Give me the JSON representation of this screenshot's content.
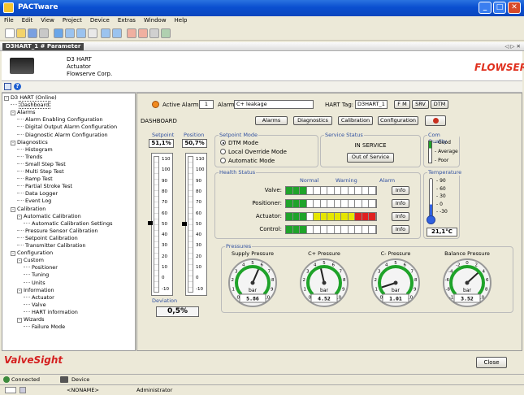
{
  "window": {
    "title": "PACTware"
  },
  "menu": [
    "File",
    "Edit",
    "View",
    "Project",
    "Device",
    "Extras",
    "Window",
    "Help"
  ],
  "doc_tab": "D3HART_1 # Parameter",
  "doc_tab_controls": "◁ ▷ ✕",
  "device": {
    "line1": "D3 HART",
    "line2": "Actuator",
    "line3": "Flowserve Corp.",
    "logo": "FLOWSERVE",
    "logo_color": "#e0301e"
  },
  "tree": [
    {
      "label": "D3 HART (Online)",
      "level": 0,
      "exp": "-"
    },
    {
      "label": "Dashboard",
      "level": 1,
      "exp": "",
      "selected": true
    },
    {
      "label": "Alarms",
      "level": 1,
      "exp": "-"
    },
    {
      "label": "Alarm Enabling Configuration",
      "level": 2,
      "exp": ""
    },
    {
      "label": "Digital Output Alarm Configuration",
      "level": 2,
      "exp": ""
    },
    {
      "label": "Diagnostic Alarm Configuration",
      "level": 2,
      "exp": ""
    },
    {
      "label": "Diagnostics",
      "level": 1,
      "exp": "-"
    },
    {
      "label": "Histogram",
      "level": 2,
      "exp": ""
    },
    {
      "label": "Trends",
      "level": 2,
      "exp": ""
    },
    {
      "label": "Small Step Test",
      "level": 2,
      "exp": ""
    },
    {
      "label": "Multi Step Test",
      "level": 2,
      "exp": ""
    },
    {
      "label": "Ramp Test",
      "level": 2,
      "exp": ""
    },
    {
      "label": "Partial Stroke Test",
      "level": 2,
      "exp": ""
    },
    {
      "label": "Data Logger",
      "level": 2,
      "exp": ""
    },
    {
      "label": "Event Log",
      "level": 2,
      "exp": ""
    },
    {
      "label": "Calibration",
      "level": 1,
      "exp": "-"
    },
    {
      "label": "Automatic Calibration",
      "level": 2,
      "exp": "-"
    },
    {
      "label": "Automatic Calibration Settings",
      "level": 3,
      "exp": ""
    },
    {
      "label": "Pressure Sensor Calibration",
      "level": 2,
      "exp": ""
    },
    {
      "label": "Setpoint Calibration",
      "level": 2,
      "exp": ""
    },
    {
      "label": "Transmitter Calibration",
      "level": 2,
      "exp": ""
    },
    {
      "label": "Configuration",
      "level": 1,
      "exp": "-"
    },
    {
      "label": "Custom",
      "level": 2,
      "exp": "-"
    },
    {
      "label": "Positioner",
      "level": 3,
      "exp": ""
    },
    {
      "label": "Tuning",
      "level": 3,
      "exp": ""
    },
    {
      "label": "Units",
      "level": 3,
      "exp": ""
    },
    {
      "label": "Information",
      "level": 2,
      "exp": "-"
    },
    {
      "label": "Actuator",
      "level": 3,
      "exp": ""
    },
    {
      "label": "Valve",
      "level": 3,
      "exp": ""
    },
    {
      "label": "HART information",
      "level": 3,
      "exp": ""
    },
    {
      "label": "Wizards",
      "level": 2,
      "exp": "-"
    },
    {
      "label": "Failure Mode",
      "level": 3,
      "exp": ""
    }
  ],
  "dashboard": {
    "active_alarms_label": "Active Alarms:",
    "active_alarms_count": "1",
    "alarm_label": "Alarm:",
    "alarm_value": "C+ leakage",
    "hart_tag_label": "HART Tag:",
    "hart_tag_value": "D3HART_1",
    "fm": "F M",
    "srv": "SRV",
    "dtm": "DTM",
    "title": "DASHBOARD",
    "buttons": {
      "alarms": "Alarms",
      "diagnostics": "Diagnostics",
      "calibration": "Calibration",
      "configuration": "Configuration"
    },
    "setpoint_label": "Setpoint",
    "setpoint_value": "51,1%",
    "position_label": "Position",
    "position_value": "50,7%",
    "scale_ticks": [
      "110",
      "100",
      "90",
      "80",
      "70",
      "60",
      "50",
      "40",
      "30",
      "20",
      "10",
      "0",
      "-10"
    ],
    "setpoint_level": 51.1,
    "position_level": 50.7,
    "deviation_label": "Deviation",
    "deviation_value": "0,5%",
    "setpoint_mode": {
      "label": "Setpoint Mode",
      "options": [
        "DTM Mode",
        "Local Override Mode",
        "Automatic Mode"
      ],
      "selected": 0
    },
    "service_status": {
      "label": "Service Status",
      "value": "IN SERVICE",
      "button": "Out of Service"
    },
    "com_quality": {
      "label": "Com Quality",
      "levels": [
        "Good",
        "Average",
        "Poor"
      ]
    },
    "health": {
      "label": "Health Status",
      "headers": [
        "Normal",
        "Warning",
        "Alarm"
      ],
      "rows": [
        {
          "name": "Valve:",
          "green": 3,
          "yellow": 0,
          "red": 0,
          "info": "Info"
        },
        {
          "name": "Positioner:",
          "green": 3,
          "yellow": 0,
          "red": 0,
          "info": "Info"
        },
        {
          "name": "Actuator:",
          "green": 3,
          "yellow": 6,
          "red": 3,
          "info": "Info"
        },
        {
          "name": "Control:",
          "green": 3,
          "yellow": 0,
          "red": 0,
          "info": "Info"
        }
      ]
    },
    "temperature": {
      "label": "Temperature",
      "ticks": [
        "90",
        "60",
        "30",
        "0",
        "-30"
      ],
      "value": "21,1°C"
    },
    "pressures": {
      "label": "Pressures",
      "gauges": [
        {
          "name": "Supply Pressure",
          "value": "5.86",
          "unit": "bar",
          "ticks": [
            "0",
            "1",
            "2",
            "3",
            "4",
            "5",
            "6",
            "7",
            "8",
            "9",
            "10"
          ],
          "frac": 0.586
        },
        {
          "name": "C+ Pressure",
          "value": "4.52",
          "unit": "bar",
          "ticks": [
            "0",
            "1",
            "2",
            "3",
            "4",
            "5",
            "6",
            "7",
            "8",
            "9",
            "10"
          ],
          "frac": 0.452
        },
        {
          "name": "C- Pressure",
          "value": "1.01",
          "unit": "bar",
          "ticks": [
            "0",
            "1",
            "2",
            "3",
            "4",
            "5",
            "6",
            "7",
            "8",
            "9",
            "10"
          ],
          "frac": 0.101
        },
        {
          "name": "Balance Pressure",
          "value": "3.52",
          "unit": "bar",
          "ticks": [
            "-10",
            "-8",
            "-6",
            "-4",
            "-2",
            "0",
            "2",
            "4",
            "6",
            "8",
            "10"
          ],
          "frac": 0.676
        }
      ]
    }
  },
  "footer": {
    "brand": "ValveSight",
    "close": "Close"
  },
  "status": {
    "connected": "Connected",
    "device": "Device",
    "noname": "<NONAME>",
    "user": "Administrator"
  },
  "colors": {
    "green": "#1fa32a",
    "yellow": "#e6e600",
    "red": "#e02020",
    "accent": "#3050a0"
  }
}
